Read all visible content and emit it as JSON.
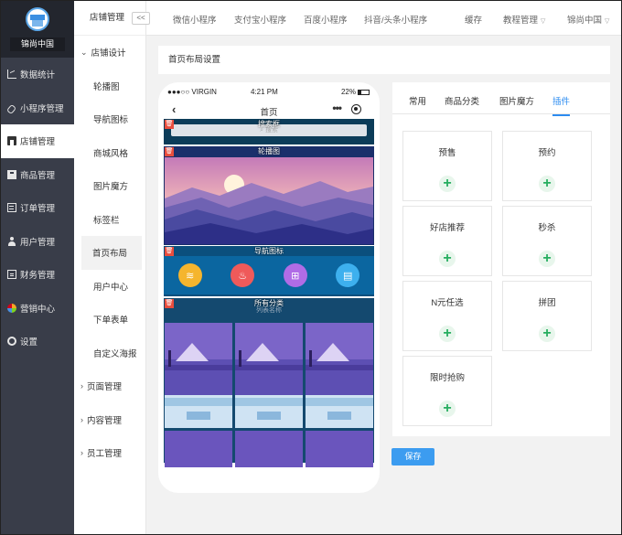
{
  "brand": {
    "name": "锦尚中国"
  },
  "sidebar": {
    "items": [
      {
        "label": "数据统计",
        "icon": "chart-icon"
      },
      {
        "label": "小程序管理",
        "icon": "link-icon"
      },
      {
        "label": "店铺管理",
        "icon": "store-icon",
        "active": true
      },
      {
        "label": "商品管理",
        "icon": "box-icon"
      },
      {
        "label": "订单管理",
        "icon": "order-icon"
      },
      {
        "label": "用户管理",
        "icon": "user-icon"
      },
      {
        "label": "财务管理",
        "icon": "money-icon"
      },
      {
        "label": "营销中心",
        "icon": "market-icon"
      },
      {
        "label": "设置",
        "icon": "gear-icon"
      }
    ]
  },
  "subnav": {
    "title": "店铺管理",
    "collapse": "<<",
    "group_open": "店铺设计",
    "items": [
      "轮播图",
      "导航图标",
      "商城风格",
      "图片魔方",
      "标签栏",
      "首页布局",
      "用户中心",
      "下单表单",
      "自定义海报"
    ],
    "active": "首页布局",
    "groups_closed": [
      "页面管理",
      "内容管理",
      "员工管理"
    ]
  },
  "topnav": {
    "links": [
      "微信小程序",
      "支付宝小程序",
      "百度小程序",
      "抖音/头条小程序"
    ],
    "cache": "缓存",
    "tutorial": "教程管理",
    "account": "锦尚中国"
  },
  "breadcrumb": "首页布局设置",
  "phone": {
    "carrier": "●●●○○ VIRGIN",
    "time": "4:21 PM",
    "battery": "22%",
    "title": "首页",
    "modules": {
      "search": {
        "label": "搜索框",
        "placeholder": "搜索"
      },
      "banner": {
        "label": "轮播图"
      },
      "nav": {
        "label": "导航图标"
      },
      "category": {
        "label": "所有分类",
        "sublabel": "列表名称"
      }
    },
    "nav_icon_colors": [
      "#f5b52e",
      "#ef5a5a",
      "#b06ce6",
      "#3db0ee"
    ]
  },
  "tabs": [
    {
      "label": "常用"
    },
    {
      "label": "商品分类"
    },
    {
      "label": "图片魔方"
    },
    {
      "label": "插件",
      "active": true
    }
  ],
  "plugins": [
    {
      "name": "预售"
    },
    {
      "name": "预约"
    },
    {
      "name": "好店推荐"
    },
    {
      "name": "秒杀"
    },
    {
      "name": "N元任选"
    },
    {
      "name": "拼团"
    },
    {
      "name": "限时抢购"
    }
  ],
  "save_label": "保存",
  "colors": {
    "sidebar": "#393d49",
    "accent": "#2d8cf0",
    "save": "#3c9cf0",
    "delete": "#e84d3d",
    "plus": "#27ae60"
  }
}
